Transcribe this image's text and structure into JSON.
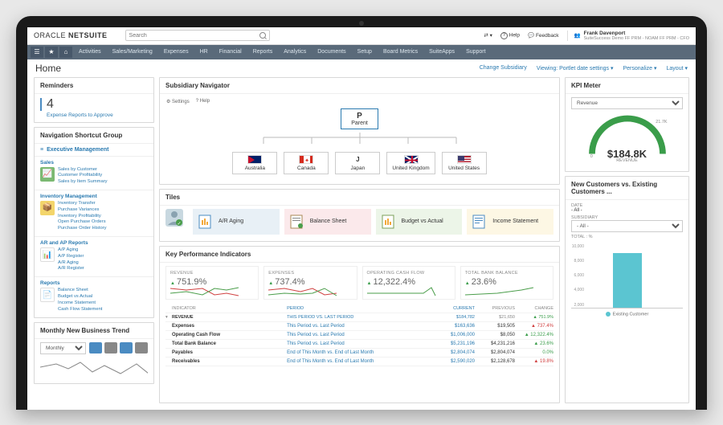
{
  "brand": {
    "logo": "ORACLE NETSUITE"
  },
  "search": {
    "placeholder": "Search"
  },
  "top_actions": {
    "help": "Help",
    "feedback": "Feedback"
  },
  "user": {
    "name": "Frank Davenport",
    "role": "SuiteSuccess Demo FF PRM - NOAM FF PRM - CFO"
  },
  "nav": [
    "Activities",
    "Sales/Marketing",
    "Expenses",
    "HR",
    "Financial",
    "Reports",
    "Analytics",
    "Documents",
    "Setup",
    "Board Metrics",
    "SuiteApps",
    "Support"
  ],
  "page": {
    "title": "Home"
  },
  "page_links": {
    "change_sub": "Change Subsidiary",
    "viewing": "Viewing: Portlet date settings ▾",
    "personalize": "Personalize ▾",
    "layout": "Layout ▾"
  },
  "reminders": {
    "title": "Reminders",
    "count": "4",
    "text": "Expense Reports to Approve"
  },
  "nsg": {
    "title": "Navigation Shortcut Group",
    "header": "Executive Management",
    "sections": [
      {
        "name": "Sales",
        "links": [
          "Sales by Customer",
          "Customer Profitability",
          "Sales by Item Summary"
        ]
      },
      {
        "name": "Inventory Management",
        "links": [
          "Inventory Transfer",
          "Purchase Variances",
          "Inventory Profitability",
          "Open Purchase Orders",
          "Purchase Order History"
        ]
      },
      {
        "name": "AR and AP Reports",
        "links": [
          "A/P Aging",
          "A/P Register",
          "A/R Aging",
          "A/R Register"
        ]
      },
      {
        "name": "Reports",
        "links": [
          "Balance Sheet",
          "Budget vs Actual",
          "Income Statement",
          "Cash Flow Statement"
        ]
      }
    ]
  },
  "trend": {
    "title": "Monthly New Business Trend",
    "period": "Monthly"
  },
  "navigator": {
    "title": "Subsidiary Navigator",
    "settings": "Settings",
    "help": "Help",
    "parent_short": "P",
    "parent": "Parent",
    "children": [
      {
        "short": "",
        "name": "Australia"
      },
      {
        "short": "",
        "name": "Canada"
      },
      {
        "short": "J",
        "name": "Japan"
      },
      {
        "short": "",
        "name": "United Kingdom"
      },
      {
        "short": "",
        "name": "United States"
      }
    ]
  },
  "tiles": {
    "title": "Tiles",
    "items": [
      "A/R Aging",
      "Balance Sheet",
      "Budget vs Actual",
      "Income Statement"
    ]
  },
  "kpi": {
    "title": "Key Performance Indicators",
    "cards": [
      {
        "label": "REVENUE",
        "val": "751.9%",
        "spark": "green"
      },
      {
        "label": "EXPENSES",
        "val": "737.4%",
        "spark": "red"
      },
      {
        "label": "OPERATING CASH FLOW",
        "val": "12,322.4%",
        "spark": "green"
      },
      {
        "label": "TOTAL BANK BALANCE",
        "val": "23.6%",
        "spark": "green"
      }
    ],
    "table": {
      "headers": [
        "",
        "INDICATOR",
        "PERIOD",
        "CURRENT",
        "PREVIOUS",
        "CHANGE"
      ],
      "rows": [
        [
          "▾",
          "Revenue",
          "This Period vs. Last Period",
          "$184,782",
          "$21,650",
          "▲ 751.9%",
          "up"
        ],
        [
          "",
          "Expenses",
          "This Period vs. Last Period",
          "$163,636",
          "$19,505",
          "▲ 737.4%",
          "down"
        ],
        [
          "",
          "Operating Cash Flow",
          "This Period vs. Last Period",
          "$1,006,000",
          "$8,050",
          "▲ 12,322.4%",
          "up"
        ],
        [
          "",
          "Total Bank Balance",
          "This Period vs. Last Period",
          "$5,231,196",
          "$4,231,216",
          "▲ 23.6%",
          "up"
        ],
        [
          "",
          "Payables",
          "End of This Month vs. End of Last Month",
          "$2,804,074",
          "$2,804,074",
          "0.0%",
          "up"
        ],
        [
          "",
          "Receivables",
          "End of This Month vs. End of Last Month",
          "$2,590,020",
          "$2,128,678",
          "▲ 19.8%",
          "down"
        ]
      ]
    }
  },
  "meter": {
    "title": "KPI Meter",
    "select": "Revenue",
    "low": "0",
    "high": "21.7K",
    "value": "$184.8K",
    "label": "REVENUE"
  },
  "custreport": {
    "title": "New Customers vs. Existing Customers ...",
    "date_label": "DATE",
    "date_val": "- All -",
    "sub_label": "SUBSIDIARY",
    "sub_val": "- All -",
    "total_label": "TOTAL : %",
    "legend": "Existing Customer"
  },
  "chart_data": {
    "type": "bar",
    "categories": [
      "Existing Customer"
    ],
    "values": [
      8500
    ],
    "yticks": [
      "10,000",
      "8,000",
      "6,000",
      "4,000",
      "2,000"
    ],
    "ylim": [
      0,
      10000
    ]
  }
}
